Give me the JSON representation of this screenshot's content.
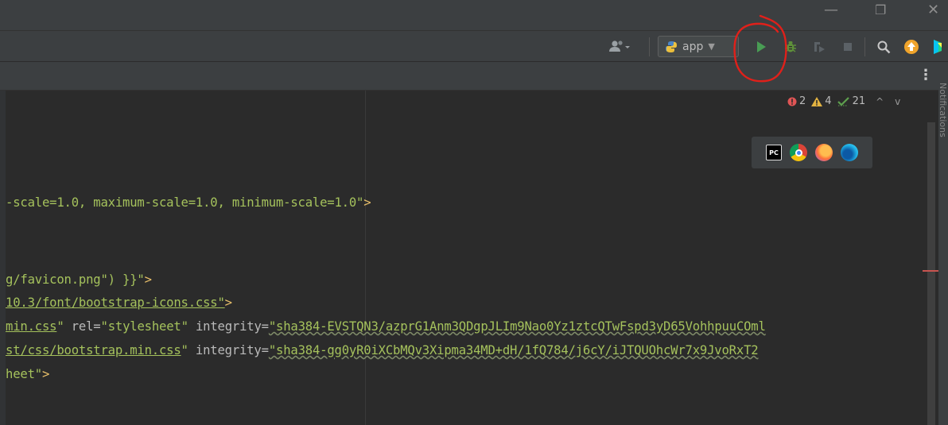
{
  "titlebar": {
    "minimize_glyph": "—",
    "restore_glyph": "❐",
    "close_glyph": "✕"
  },
  "toolbar": {
    "run_config": "app",
    "icons": [
      "user-account-icon",
      "python-icon",
      "run-icon",
      "debug-icon",
      "coverage-icon",
      "stop-icon",
      "search-icon",
      "update-icon",
      "jetbrains-logo-icon"
    ]
  },
  "tabsbar": {
    "menu_glyph": "⋮"
  },
  "notifications_label": "Notifications",
  "inspections": {
    "errors": "2",
    "warnings": "4",
    "weak_warnings": "21",
    "up_glyph": "^",
    "down_glyph": "v"
  },
  "browsers": [
    "PC",
    "",
    "",
    ""
  ],
  "code": {
    "line1": {
      "a": "-scale=1.0, maximum-scale=1.0, minimum-scale=1.0\"",
      "b": ">"
    },
    "line2": {
      "a": "g/favicon.png\") }}\"",
      "b": ">"
    },
    "line3": {
      "a": "10.3/font/bootstrap-icons.css\"",
      "b": ">"
    },
    "line4": {
      "a": "min.css",
      "b": "\" ",
      "c": "rel",
      "d": "=",
      "e": "\"stylesheet\"",
      "f": " integrity",
      "g": "=",
      "h": "\"sha384-EVSTQN3/azprG1Anm3QDgpJLIm9Nao0Yz1ztcQTwFspd3yD65VohhpuuCOml"
    },
    "line5": {
      "a": "st/css/bootstrap.min.css",
      "b": "\" ",
      "c": "integrity",
      "d": "=",
      "e": "\"sha384-gg0yR0iXCbMQv3Xipma34MD+dH/1fQ784/j6cY/iJTQUOhcWr7x9JvoRxT2"
    },
    "line6": {
      "a": "heet\"",
      "b": ">"
    }
  },
  "colors": {
    "editor_bg": "#2b2b2b",
    "chrome_bg": "#3c3f41",
    "string": "#a5c25c",
    "tag": "#e8bf6a",
    "run_green": "#499c54",
    "error_red": "#e05555",
    "warning_yellow": "#e3b341",
    "annotation_red": "#e0201a"
  }
}
